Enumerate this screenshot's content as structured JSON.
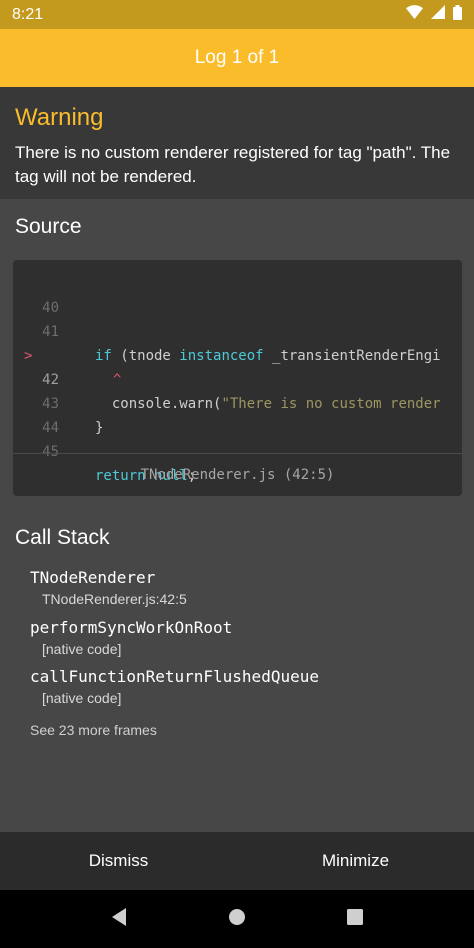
{
  "status_bar": {
    "time": "8:21",
    "icons": [
      "wifi-icon",
      "signal-icon",
      "battery-icon"
    ]
  },
  "header": {
    "title": "Log 1 of 1",
    "background": "#fbbc2b"
  },
  "warning": {
    "title": "Warning",
    "message": "There is no custom renderer registered for tag \"path\". The tag will not be rendered."
  },
  "source": {
    "title": "Source",
    "lines": [
      {
        "number": "40",
        "marker": "",
        "code": ""
      },
      {
        "number": "41",
        "marker": "",
        "code": "if (tnode instanceof _transientRenderEngi"
      },
      {
        "number": "42",
        "marker": ">",
        "code": "  console.warn(\"There is no custom render"
      },
      {
        "number": "",
        "marker": "",
        "code": "^"
      },
      {
        "number": "43",
        "marker": "",
        "code": "}"
      },
      {
        "number": "44",
        "marker": "",
        "code": ""
      },
      {
        "number": "45",
        "marker": "",
        "code": "return null;"
      }
    ],
    "file": "TNodeRenderer.js (42:5)"
  },
  "call_stack": {
    "title": "Call Stack",
    "frames": [
      {
        "name": "TNodeRenderer",
        "location": "TNodeRenderer.js:42:5"
      },
      {
        "name": "performSyncWorkOnRoot",
        "location": "[native code]"
      },
      {
        "name": "callFunctionReturnFlushedQueue",
        "location": "[native code]"
      }
    ],
    "more": "See 23 more frames"
  },
  "actions": {
    "dismiss": "Dismiss",
    "minimize": "Minimize"
  },
  "nav_bar": {
    "icons": [
      "back-icon",
      "home-icon",
      "recents-icon"
    ]
  }
}
